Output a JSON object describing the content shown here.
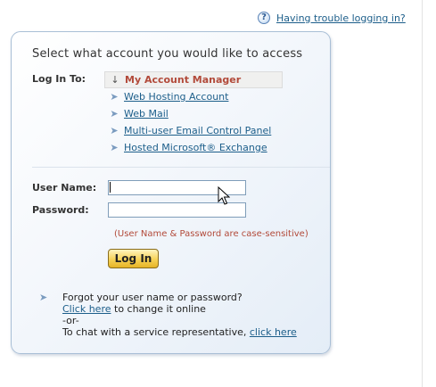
{
  "help": {
    "icon": "question-mark-icon",
    "link_text": "Having trouble logging in?"
  },
  "panel": {
    "title": "Select what account you would like to access",
    "login_to_label": "Log In To:",
    "selected": {
      "icon": "arrow-down-icon",
      "label": "My Account Manager"
    },
    "options": [
      {
        "label": "Web Hosting Account",
        "icon": "arrow-right-icon"
      },
      {
        "label": "Web Mail",
        "icon": "arrow-right-icon"
      },
      {
        "label": "Multi-user Email Control Panel",
        "icon": "arrow-right-icon"
      },
      {
        "label": "Hosted Microsoft® Exchange",
        "icon": "arrow-right-icon"
      }
    ],
    "username_label": "User Name:",
    "username_value": "",
    "password_label": "Password:",
    "password_value": "",
    "case_note": "(User Name & Password are case-sensitive)",
    "login_button": "Log In"
  },
  "footer": {
    "forgot_text": "Forgot your user name or password?",
    "click_here": "Click here",
    "change_text": "to change it online",
    "or_text": "-or-",
    "chat_text": "To chat with a service representative,",
    "chat_link": "click here"
  },
  "colors": {
    "link": "#1c5e8a",
    "accent_red": "#b24a3a",
    "button_gold": "#f6d257",
    "panel_border": "#a9bfd6"
  }
}
